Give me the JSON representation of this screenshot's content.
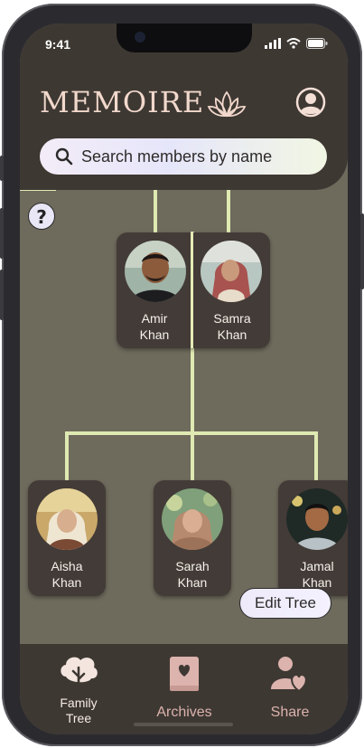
{
  "status_bar": {
    "time": "9:41"
  },
  "header": {
    "logo_text": "MEMOIRE",
    "search_placeholder": "Search members by name"
  },
  "help_label": "?",
  "members": {
    "amir": {
      "first": "Amir",
      "last": "Khan"
    },
    "samra": {
      "first": "Samra",
      "last": "Khan"
    },
    "aisha": {
      "first": "Aisha",
      "last": "Khan"
    },
    "sarah": {
      "first": "Sarah",
      "last": "Khan"
    },
    "jamal": {
      "first": "Jamal",
      "last": "Khan"
    }
  },
  "edit_tree_label": "Edit Tree",
  "bottom_nav": {
    "family_tree": {
      "line1": "Family",
      "line2": "Tree"
    },
    "archives": "Archives",
    "share": "Share"
  },
  "colors": {
    "screen_bg": "#6e6a5c",
    "header_bg": "#3e3833",
    "card_bg": "#433b37",
    "accent_text": "#f0d5cb",
    "tree_line": "#dfe9b2"
  },
  "icons": [
    "search-icon",
    "lotus-icon",
    "profile-icon",
    "tree-icon",
    "book-heart-icon",
    "share-heart-icon",
    "signal-icon",
    "wifi-icon",
    "battery-icon"
  ]
}
